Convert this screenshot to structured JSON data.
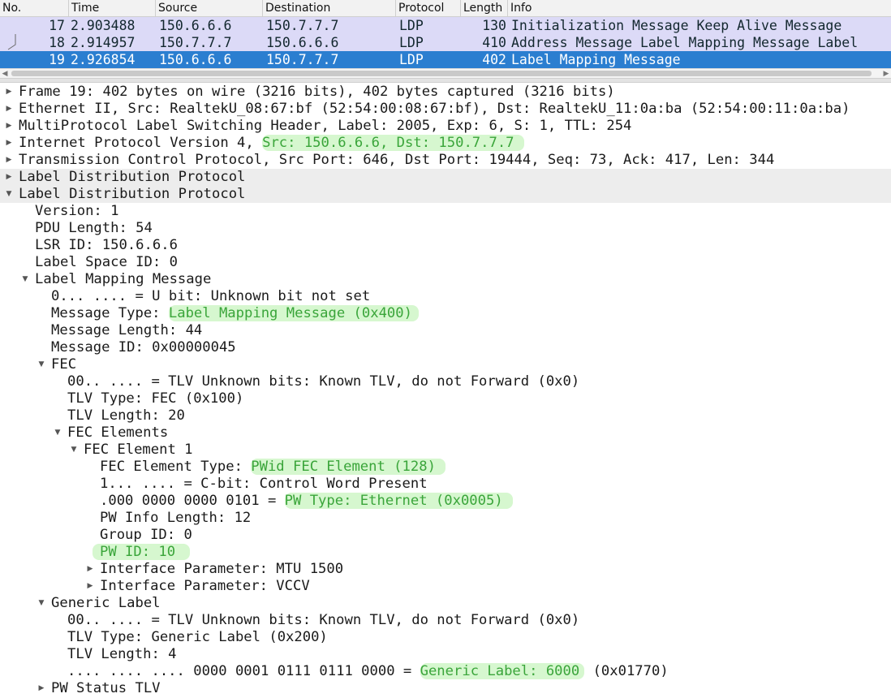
{
  "packet_list": {
    "columns": [
      "No.",
      "Time",
      "Source",
      "Destination",
      "Protocol",
      "Length",
      "Info"
    ],
    "rows": [
      {
        "no": "17",
        "time": "2.903488",
        "source": "150.6.6.6",
        "destination": "150.7.7.7",
        "protocol": "LDP",
        "length": "130",
        "info": "Initialization Message Keep Alive Message"
      },
      {
        "no": "18",
        "time": "2.914957",
        "source": "150.7.7.7",
        "destination": "150.6.6.6",
        "protocol": "LDP",
        "length": "410",
        "info": "Address Message Label Mapping Message Label"
      },
      {
        "no": "19",
        "time": "2.926854",
        "source": "150.6.6.6",
        "destination": "150.7.7.7",
        "protocol": "LDP",
        "length": "402",
        "info": "Label Mapping Message"
      }
    ],
    "selected_row": 2,
    "row_colors": {
      "ldp": "#dcdaf7",
      "selected": "#2b7ed0"
    }
  },
  "details": {
    "frame": "Frame 19: 402 bytes on wire (3216 bits), 402 bytes captured (3216 bits)",
    "ethernet": "Ethernet II, Src: RealtekU_08:67:bf (52:54:00:08:67:bf), Dst: RealtekU_11:0a:ba (52:54:00:11:0a:ba)",
    "mpls": "MultiProtocol Label Switching Header, Label: 2005, Exp: 6, S: 1, TTL: 254",
    "ip": {
      "prefix": "Internet Protocol Version 4, ",
      "hl": "Src: 150.6.6.6, Dst: 150.7.7.7"
    },
    "tcp": "Transmission Control Protocol, Src Port: 646, Dst Port: 19444, Seq: 73, Ack: 417, Len: 344",
    "ldp1": "Label Distribution Protocol",
    "ldp2": "Label Distribution Protocol",
    "version": "Version: 1",
    "pdu_length": "PDU Length: 54",
    "lsr_id": "LSR ID: 150.6.6.6",
    "label_space_id": "Label Space ID: 0",
    "label_mapping": "Label Mapping Message",
    "u_bit": "0... .... = U bit: Unknown bit not set",
    "msg_type": {
      "prefix": "Message Type: ",
      "hl": "Label Mapping Message (0x400)"
    },
    "msg_length": "Message Length: 44",
    "msg_id": "Message ID: 0x00000045",
    "fec": "FEC",
    "fec_unknown_bits": "00.. .... = TLV Unknown bits: Known TLV, do not Forward (0x0)",
    "fec_tlv_type": "TLV Type: FEC (0x100)",
    "fec_tlv_length": "TLV Length: 20",
    "fec_elements": "FEC Elements",
    "fec_element_1": "FEC Element 1",
    "fec_element_type": {
      "prefix": "FEC Element Type: ",
      "hl": "PWid FEC Element (128)"
    },
    "c_bit": "1... .... = C-bit: Control Word Present",
    "pw_type": {
      "prefix": ".000 0000 0000 0101 = ",
      "hl": "PW Type: Ethernet (0x0005)"
    },
    "pw_info_length": "PW Info Length: 12",
    "group_id": "Group ID: 0",
    "pw_id": {
      "hl": "PW ID: 10"
    },
    "if_param_mtu": "Interface Parameter: MTU 1500",
    "if_param_vccv": "Interface Parameter: VCCV",
    "generic_label": "Generic Label",
    "gl_unknown_bits": "00.. .... = TLV Unknown bits: Known TLV, do not Forward (0x0)",
    "gl_tlv_type": "TLV Type: Generic Label (0x200)",
    "gl_tlv_length": "TLV Length: 4",
    "gl_value": {
      "prefix": ".... .... .... 0000 0001 0111 0111 0000 = ",
      "hl": "Generic Label: 6000",
      "suffix": " (0x01770)"
    },
    "pw_status": "PW Status TLV",
    "highlight_color": "#3aa53a",
    "highlight_bg": "#d6f7cf"
  }
}
